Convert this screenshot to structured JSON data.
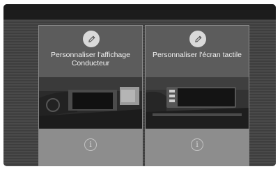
{
  "cards": [
    {
      "label": "Personnaliser l'affichage\nConducteur",
      "edit_icon": "pencil-icon",
      "info_icon": "info-icon"
    },
    {
      "label": "Personnaliser l'écran tactile",
      "edit_icon": "pencil-icon",
      "info_icon": "info-icon"
    }
  ],
  "info_glyph": "i",
  "colors": {
    "screen_background": "#3a3a3a",
    "card_background": "#505050",
    "info_area": "#8d8d8d",
    "icon_circle": "#d9d9d9"
  }
}
